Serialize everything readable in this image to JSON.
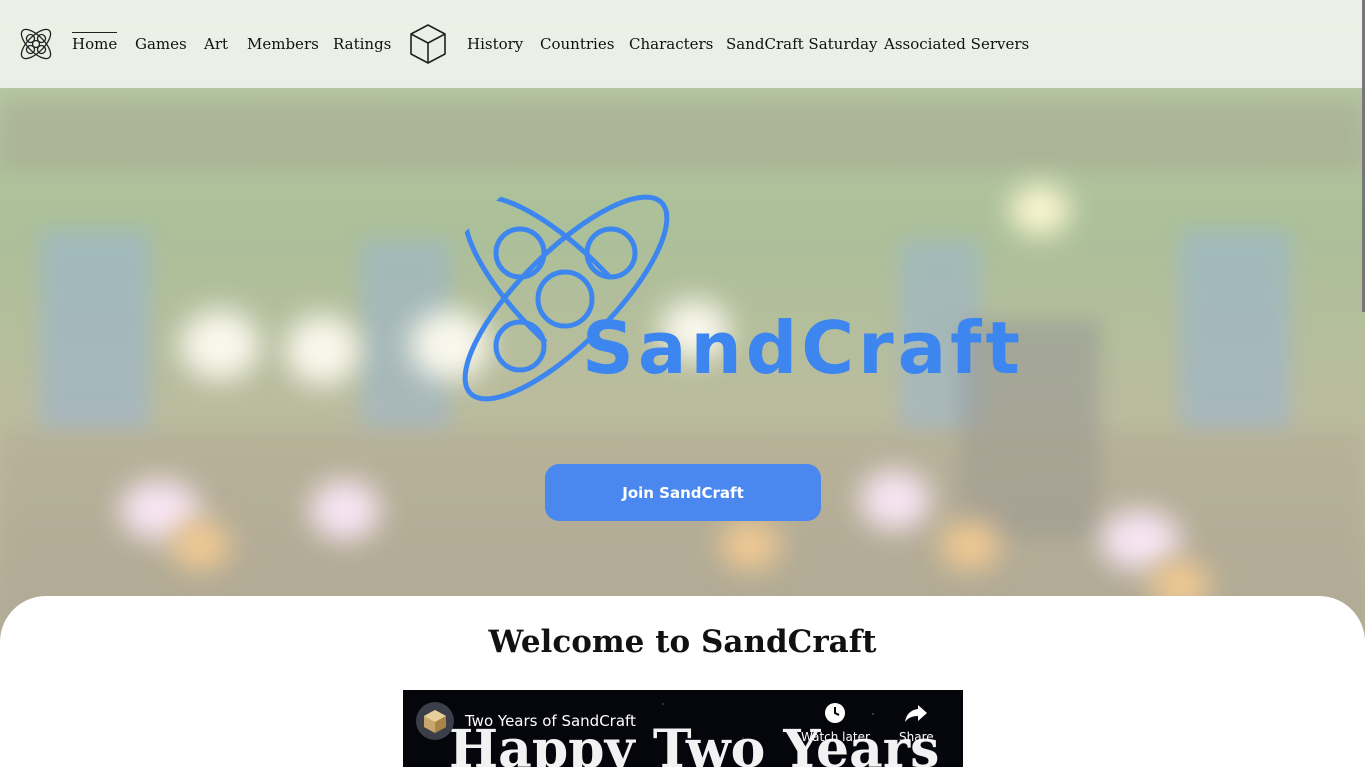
{
  "nav": {
    "items": [
      {
        "label": "Home",
        "active": true
      },
      {
        "label": "Games"
      },
      {
        "label": "Art"
      },
      {
        "label": "Members"
      },
      {
        "label": "Ratings"
      }
    ],
    "items_right": [
      {
        "label": "History"
      },
      {
        "label": "Countries"
      },
      {
        "label": "Characters"
      },
      {
        "label": "SandCraft Saturday"
      },
      {
        "label": "Associated Servers"
      }
    ],
    "brand_icon": "sandcraft-logo-icon",
    "cube_icon": "cube-icon"
  },
  "hero": {
    "logo_text": "SandCraft",
    "join_label": "Join SandCraft"
  },
  "main": {
    "welcome_title": "Welcome to SandCraft",
    "video": {
      "title": "Two Years of SandCraft",
      "overlay_text": "Happy Two Years",
      "watch_later_label": "Watch later",
      "share_label": "Share"
    }
  },
  "colors": {
    "accent": "#4a88f0",
    "logo_blue": "#3e86ef"
  }
}
